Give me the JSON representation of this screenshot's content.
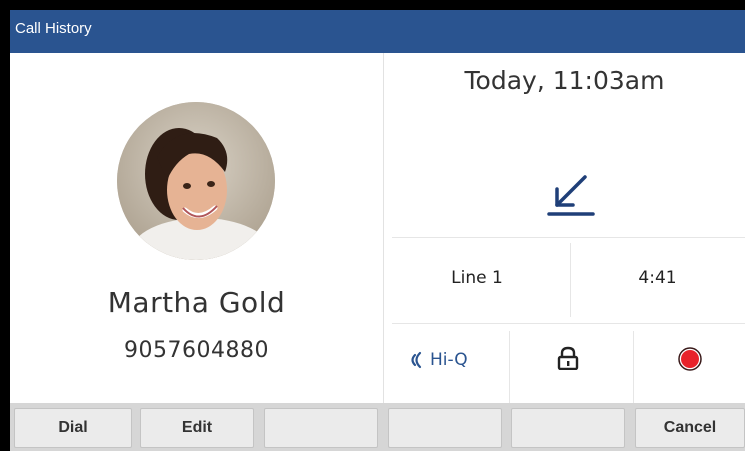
{
  "titlebar": {
    "title": "Call History"
  },
  "contact": {
    "name": "Martha Gold",
    "number": "9057604880"
  },
  "call": {
    "datetime": "Today, 11:03am",
    "direction_icon": "incoming-call-arrow-icon",
    "line": "Line 1",
    "duration": "4:41"
  },
  "features": {
    "hiq_label": "Hi-Q",
    "hiq_icon": "hiq-audio-icon",
    "lock_icon": "lock-icon",
    "record_icon": "record-icon"
  },
  "softkeys": [
    {
      "label": "Dial"
    },
    {
      "label": "Edit"
    },
    {
      "label": ""
    },
    {
      "label": ""
    },
    {
      "label": ""
    },
    {
      "label": "Cancel"
    }
  ],
  "colors": {
    "titlebar": "#2a5490",
    "accent": "#1f3f78",
    "record": "#e8222a",
    "softkey_bar": "#d6d6d6"
  }
}
